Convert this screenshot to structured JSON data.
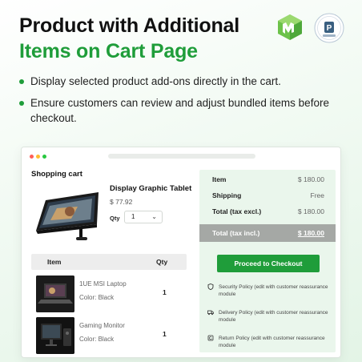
{
  "headline": {
    "line1": "Product with Additional",
    "line2": "Items on Cart Page"
  },
  "badges": {
    "left_logo_icon": "green-cube-logo-icon",
    "right_logo_icon": "prestashop-agency-badge-icon",
    "right_logo_letter": "P"
  },
  "features": [
    "Display selected product add-ons directly in the cart.",
    "Ensure customers can review and adjust bundled items before checkout."
  ],
  "browser": {
    "window_dots": [
      "#ff5f57",
      "#ffbd2e",
      "#28c840"
    ]
  },
  "cart": {
    "title": "Shopping cart",
    "product": {
      "name": "Display Graphic Tablet",
      "price": "$ 77.92",
      "qty_label": "Qty",
      "qty_value": "1",
      "image_icon": "graphic-tablet-icon"
    },
    "table": {
      "col_item": "Item",
      "col_qty": "Qty",
      "rows": [
        {
          "name": "1UE MSI Laptop",
          "color": "Color: Black",
          "qty": "1",
          "image_icon": "laptop-icon"
        },
        {
          "name": "Gaming Monitor",
          "color": "Color: Black",
          "qty": "1",
          "image_icon": "monitor-icon"
        }
      ]
    }
  },
  "summary": {
    "rows": [
      {
        "label": "Item",
        "value": "$ 180.00"
      },
      {
        "label": "Shipping",
        "value": "Free"
      },
      {
        "label": "Total (tax excl.)",
        "value": "$ 180.00"
      }
    ],
    "total_label": "Total (tax incl.)",
    "total_value": "$ 180.00",
    "checkout_label": "Proceed to Checkout",
    "policies": [
      {
        "text": "Security Policy (edit with customer reassurance module",
        "icon": "shield-icon"
      },
      {
        "text": "Delivery Policy (edit with customer reassurance module",
        "icon": "truck-icon"
      },
      {
        "text": "Return Policy (edit with customer reassurance module",
        "icon": "return-icon"
      }
    ]
  },
  "colors": {
    "accent": "#1f9d3a",
    "summary_bg": "#eaf6ec",
    "total_bg": "#a5a8a5"
  }
}
